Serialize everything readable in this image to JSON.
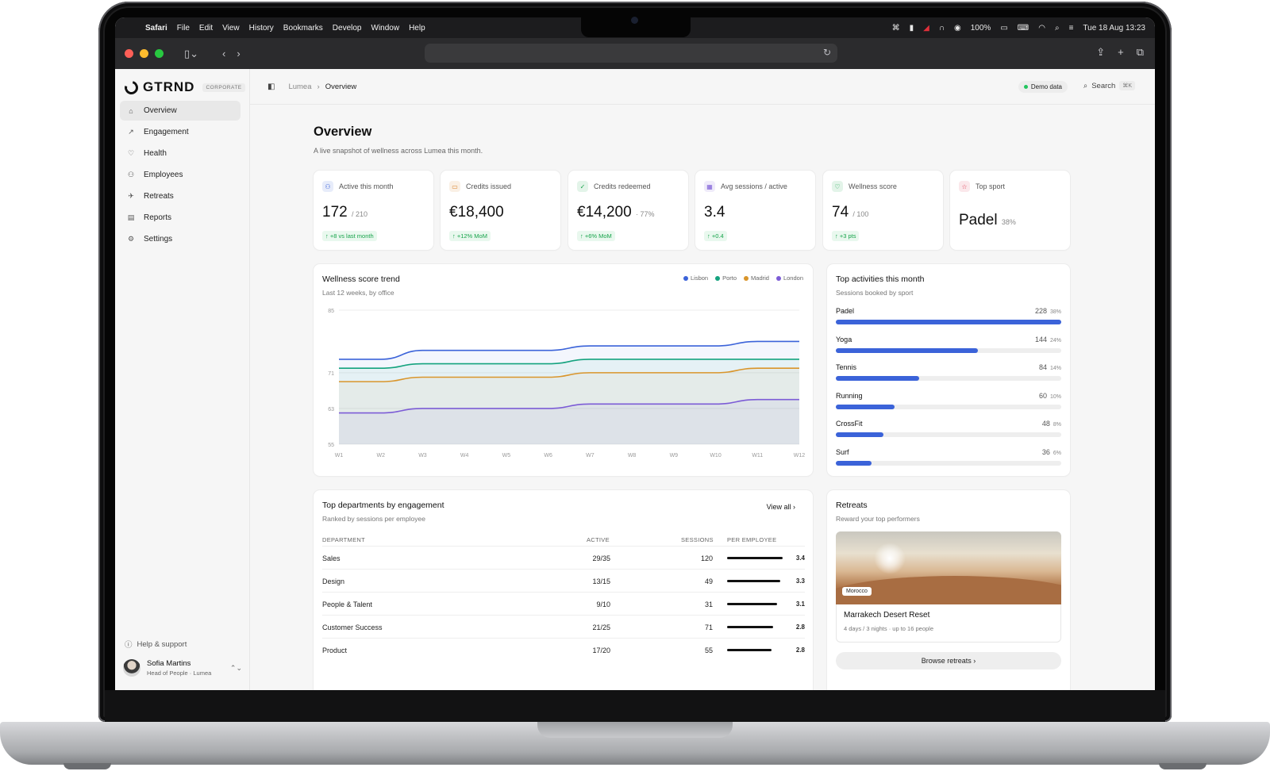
{
  "menubar": {
    "app": "Safari",
    "items": [
      "File",
      "Edit",
      "View",
      "History",
      "Bookmarks",
      "Develop",
      "Window",
      "Help"
    ],
    "battery": "100%",
    "clock": "Tue 18 Aug  13:23"
  },
  "brand": {
    "name": "GTRND",
    "tag": "CORPORATE"
  },
  "sidebar": {
    "items": [
      {
        "label": "Overview",
        "icon": "home-icon"
      },
      {
        "label": "Engagement",
        "icon": "trend-icon"
      },
      {
        "label": "Health",
        "icon": "heart-pulse-icon"
      },
      {
        "label": "Employees",
        "icon": "users-icon"
      },
      {
        "label": "Retreats",
        "icon": "plane-icon"
      },
      {
        "label": "Reports",
        "icon": "document-icon"
      },
      {
        "label": "Settings",
        "icon": "gear-icon"
      }
    ],
    "help": "Help & support",
    "user": {
      "name": "Sofia Martins",
      "role": "Head of People · Lumea"
    }
  },
  "topbar": {
    "breadcrumb": [
      "Lumea",
      "Overview"
    ],
    "demo": "Demo data",
    "search": "Search",
    "shortcut": "⌘K"
  },
  "page": {
    "title": "Overview",
    "subtitle": "A live snapshot of wellness across Lumea this month."
  },
  "kpis": [
    {
      "label": "Active this month",
      "value": "172",
      "sub": "/ 210",
      "badge": "↑ +8 vs last month",
      "icon": "users-icon",
      "color": "#3b63d9"
    },
    {
      "label": "Credits issued",
      "value": "€18,400",
      "sub": "",
      "badge": "↑ +12% MoM",
      "icon": "card-icon",
      "color": "#d9822b"
    },
    {
      "label": "Credits redeemed",
      "value": "€14,200",
      "sub": "· 77%",
      "badge": "↑ +6% MoM",
      "icon": "check-circle-icon",
      "color": "#16a34a"
    },
    {
      "label": "Avg sessions / active",
      "value": "3.4",
      "sub": "",
      "badge": "↑ +0.4",
      "icon": "calendar-icon",
      "color": "#7c5cd6"
    },
    {
      "label": "Wellness score",
      "value": "74",
      "sub": "/ 100",
      "badge": "↑ +3 pts",
      "icon": "heart-pulse-icon",
      "color": "#16a34a"
    },
    {
      "label": "Top sport",
      "value": "Padel",
      "sub": "38%",
      "badge": "",
      "icon": "star-icon",
      "color": "#e0445a"
    }
  ],
  "trend": {
    "title": "Wellness score trend",
    "subtitle": "Last 12 weeks, by office"
  },
  "chart_data": {
    "type": "line",
    "x": [
      "W1",
      "W2",
      "W3",
      "W4",
      "W5",
      "W6",
      "W7",
      "W8",
      "W9",
      "W10",
      "W11",
      "W12"
    ],
    "yticks": [
      55,
      63,
      71,
      85
    ],
    "ylim": [
      55,
      85
    ],
    "grid": true,
    "legend": "top-right",
    "series": [
      {
        "name": "Lisbon",
        "color": "#3b63d9",
        "values": [
          74,
          74,
          76,
          76,
          76,
          76,
          77,
          77,
          77,
          77,
          78,
          78
        ]
      },
      {
        "name": "Porto",
        "color": "#15a37f",
        "values": [
          72,
          72,
          73,
          73,
          73,
          73,
          74,
          74,
          74,
          74,
          74,
          74
        ]
      },
      {
        "name": "Madrid",
        "color": "#d9952b",
        "values": [
          69,
          69,
          70,
          70,
          70,
          70,
          71,
          71,
          71,
          71,
          72,
          72
        ]
      },
      {
        "name": "London",
        "color": "#7c5cd6",
        "values": [
          62,
          62,
          63,
          63,
          63,
          63,
          64,
          64,
          64,
          64,
          65,
          65
        ]
      }
    ]
  },
  "activities": {
    "title": "Top activities this month",
    "subtitle": "Sessions booked by sport",
    "items": [
      {
        "name": "Padel",
        "count": "228",
        "pct": "38%",
        "share": 1.0
      },
      {
        "name": "Yoga",
        "count": "144",
        "pct": "24%",
        "share": 0.63
      },
      {
        "name": "Tennis",
        "count": "84",
        "pct": "14%",
        "share": 0.37
      },
      {
        "name": "Running",
        "count": "60",
        "pct": "10%",
        "share": 0.26
      },
      {
        "name": "CrossFit",
        "count": "48",
        "pct": "8%",
        "share": 0.21
      },
      {
        "name": "Surf",
        "count": "36",
        "pct": "6%",
        "share": 0.16
      }
    ]
  },
  "departments": {
    "title": "Top departments by engagement",
    "subtitle": "Ranked by sessions per employee",
    "view_all": "View all",
    "headers": [
      "DEPARTMENT",
      "ACTIVE",
      "SESSIONS",
      "PER EMPLOYEE"
    ],
    "rows": [
      {
        "name": "Sales",
        "active": "29/35",
        "sessions": "120",
        "per": "3.4",
        "share": 1.0
      },
      {
        "name": "Design",
        "active": "13/15",
        "sessions": "49",
        "per": "3.3",
        "share": 0.95
      },
      {
        "name": "People & Talent",
        "active": "9/10",
        "sessions": "31",
        "per": "3.1",
        "share": 0.9
      },
      {
        "name": "Customer Success",
        "active": "21/25",
        "sessions": "71",
        "per": "2.8",
        "share": 0.83
      },
      {
        "name": "Product",
        "active": "17/20",
        "sessions": "55",
        "per": "2.8",
        "share": 0.8
      }
    ]
  },
  "retreats": {
    "title": "Retreats",
    "subtitle": "Reward your top performers",
    "tag": "Morocco",
    "name": "Marrakech Desert Reset",
    "details": "4 days / 3 nights · up to 16 people",
    "browse": "Browse retreats"
  }
}
